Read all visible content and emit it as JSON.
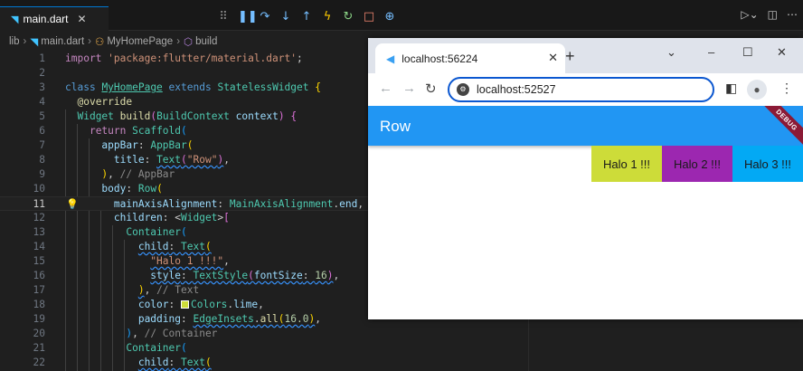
{
  "editor": {
    "tab": {
      "filename": "main.dart",
      "close": "✕"
    },
    "breadcrumb": [
      "lib",
      "main.dart",
      "MyHomePage",
      "build"
    ],
    "debug_colors": {
      "pause": "#75beff",
      "step": "#75beff",
      "hot_reload": "#ffcc00",
      "restart": "#89d185",
      "stop": "#f48771",
      "inspect": "#75beff"
    },
    "active_line": 11,
    "line_numbers": [
      "1",
      "2",
      "3",
      "4",
      "5",
      "6",
      "7",
      "8",
      "9",
      "10",
      "11",
      "12",
      "13",
      "14",
      "15",
      "16",
      "17",
      "18",
      "19",
      "20",
      "21",
      "22"
    ]
  },
  "browser": {
    "tab_title": "localhost:56224",
    "tab_close": "✕",
    "new_tab": "+",
    "window_controls": {
      "minimize": "–",
      "maximize": "☐",
      "close": "✕",
      "tab_list": "⌄"
    },
    "url": "localhost:52527",
    "app": {
      "title": "Row",
      "debug_banner": "DEBUG",
      "appbar_color": "#2196f3",
      "boxes": [
        {
          "label": "Halo 1 !!!",
          "color": "#cddc39"
        },
        {
          "label": "Halo 2 !!!",
          "color": "#9c27b0"
        },
        {
          "label": "Halo 3 !!!",
          "color": "#03a9f4"
        }
      ]
    }
  }
}
